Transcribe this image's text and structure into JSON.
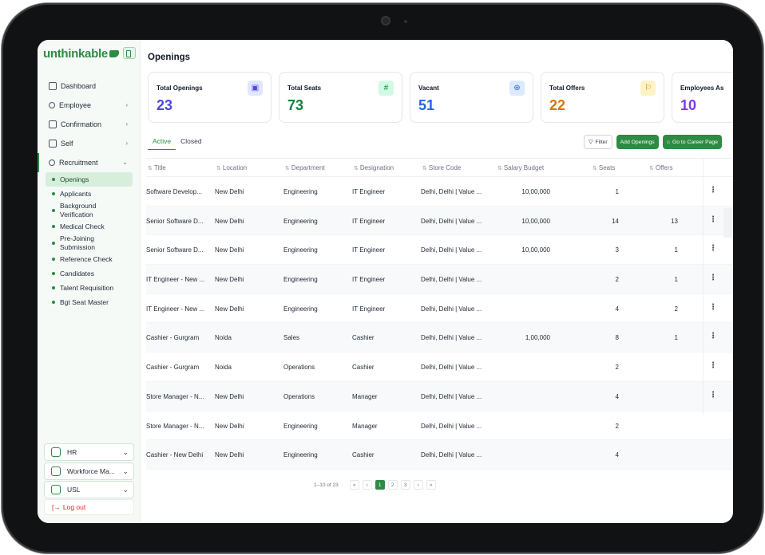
{
  "app": {
    "brand": "unthinkable",
    "page_title": "Openings"
  },
  "sidebar": {
    "items": [
      {
        "label": "Dashboard"
      },
      {
        "label": "Employee",
        "chevron": "›"
      },
      {
        "label": "Confirmation",
        "chevron": "›"
      },
      {
        "label": "Self",
        "chevron": "›"
      },
      {
        "label": "Recruitment",
        "chevron": "⌄"
      }
    ],
    "recruitment_sub": [
      {
        "label": "Openings"
      },
      {
        "label": "Applicants"
      },
      {
        "label": "Background Verification"
      },
      {
        "label": "Medical Check"
      },
      {
        "label": "Pre-Joining Submission"
      },
      {
        "label": "Reference Check"
      },
      {
        "label": "Candidates"
      },
      {
        "label": "Talent Requisition"
      },
      {
        "label": "Bgt Seat Master"
      }
    ],
    "org_selectors": [
      {
        "label": "HR"
      },
      {
        "label": "Workforce Ma..."
      },
      {
        "label": "USL"
      }
    ],
    "logout_label": "Log out",
    "logout_icon": "[→"
  },
  "cards": [
    {
      "label": "Total Openings",
      "value": "23",
      "color": "#4f46e5",
      "icon": "briefcase-icon",
      "glyph": "▣",
      "icon_bg": "#e0e7ff",
      "icon_color": "#4f46e5"
    },
    {
      "label": "Total Seats",
      "value": "73",
      "color": "#15803d",
      "icon": "hash-icon",
      "glyph": "#",
      "icon_bg": "#d1fae5",
      "icon_color": "#15803d"
    },
    {
      "label": "Vacant",
      "value": "51",
      "color": "#2563eb",
      "icon": "plus-circle-icon",
      "glyph": "⊕",
      "icon_bg": "#dbeafe",
      "icon_color": "#2563eb"
    },
    {
      "label": "Total Offers",
      "value": "22",
      "color": "#d97706",
      "icon": "flag-icon",
      "glyph": "⚐",
      "icon_bg": "#fef3c7",
      "icon_color": "#d97706"
    },
    {
      "label": "Employees As",
      "value": "10",
      "color": "#7c3aed",
      "icon": "users-icon",
      "glyph": "",
      "icon_bg": "#ffffff",
      "icon_color": "#7c3aed"
    }
  ],
  "tabs": {
    "active": "Active",
    "closed": "Closed"
  },
  "actions": {
    "filter": "Filter",
    "filter_icon": "▽",
    "add_openings": "Add Openings",
    "career_page": "Go to Career Page",
    "career_icon": "⌂"
  },
  "table": {
    "sort_icon": "⇅",
    "columns": [
      "Title",
      "Location",
      "Department",
      "Designation",
      "Store Code",
      "Salary Budget",
      "Seats",
      "Offers"
    ],
    "rows": [
      {
        "title": "Software Develop...",
        "location": "New Delhi",
        "department": "Engineering",
        "designation": "IT Engineer",
        "store_code": "Delhi, Delhi | Value ...",
        "salary": "10,00,000",
        "seats": "1",
        "offers": "",
        "menu": "⋮"
      },
      {
        "title": "Senior Software D...",
        "location": "New Delhi",
        "department": "Engineering",
        "designation": "IT Engineer",
        "store_code": "Delhi, Delhi | Value ...",
        "salary": "10,00,000",
        "seats": "14",
        "offers": "13",
        "menu": "⋮"
      },
      {
        "title": "Senior Software D...",
        "location": "New Delhi",
        "department": "Engineering",
        "designation": "IT Engineer",
        "store_code": "Delhi, Delhi | Value ...",
        "salary": "10,00,000",
        "seats": "3",
        "offers": "1",
        "menu": "⋮"
      },
      {
        "title": "IT Engineer - New ...",
        "location": "New Delhi",
        "department": "Engineering",
        "designation": "IT Engineer",
        "store_code": "Delhi, Delhi | Value ...",
        "salary": "",
        "seats": "2",
        "offers": "1",
        "menu": "⋮"
      },
      {
        "title": "IT Engineer - New ...",
        "location": "New Delhi",
        "department": "Engineering",
        "designation": "IT Engineer",
        "store_code": "Delhi, Delhi | Value ...",
        "salary": "",
        "seats": "4",
        "offers": "2",
        "menu": "⋮"
      },
      {
        "title": "Cashier - Gurgram",
        "location": "Noida",
        "department": "Sales",
        "designation": "Cashier",
        "store_code": "Delhi, Delhi | Value ...",
        "salary": "1,00,000",
        "seats": "8",
        "offers": "1",
        "menu": "⋮"
      },
      {
        "title": "Cashier - Gurgram",
        "location": "Noida",
        "department": "Operations",
        "designation": "Cashier",
        "store_code": "Delhi, Delhi | Value ...",
        "salary": "",
        "seats": "2",
        "offers": "",
        "menu": "⋮"
      },
      {
        "title": "Store Manager - N...",
        "location": "New Delhi",
        "department": "Operations",
        "designation": "Manager",
        "store_code": "Delhi, Delhi | Value ...",
        "salary": "",
        "seats": "4",
        "offers": "",
        "menu": "⋮"
      },
      {
        "title": "Store Manager - N...",
        "location": "New Delhi",
        "department": "Engineering",
        "designation": "Manager",
        "store_code": "Delhi, Delhi | Value ...",
        "salary": "",
        "seats": "2",
        "offers": "",
        "menu": ""
      },
      {
        "title": "Cashier - New Delhi",
        "location": "New Delhi",
        "department": "Engineering",
        "designation": "Cashier",
        "store_code": "Delhi, Delhi | Value ...",
        "salary": "",
        "seats": "4",
        "offers": "",
        "menu": ""
      }
    ]
  },
  "pagination": {
    "range": "1–10 of 23",
    "first": "«",
    "prev": "‹",
    "pages": [
      "1",
      "2",
      "3"
    ],
    "current": 1,
    "next": "›",
    "last": "»"
  }
}
